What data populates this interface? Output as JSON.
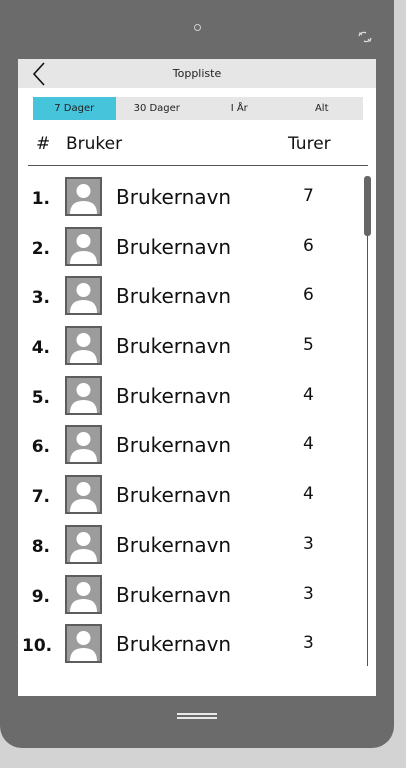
{
  "header": {
    "title": "Toppliste"
  },
  "tabs": [
    {
      "label": "7 Dager",
      "active": true
    },
    {
      "label": "30 Dager",
      "active": false
    },
    {
      "label": "I År",
      "active": false
    },
    {
      "label": "Alt",
      "active": false
    }
  ],
  "columns": {
    "rank": "#",
    "user": "Bruker",
    "trips": "Turer"
  },
  "rows": [
    {
      "rank": "1.",
      "name": "Brukernavn",
      "trips": "7"
    },
    {
      "rank": "2.",
      "name": "Brukernavn",
      "trips": "6"
    },
    {
      "rank": "3.",
      "name": "Brukernavn",
      "trips": "6"
    },
    {
      "rank": "4.",
      "name": "Brukernavn",
      "trips": "5"
    },
    {
      "rank": "5.",
      "name": "Brukernavn",
      "trips": "4"
    },
    {
      "rank": "6.",
      "name": "Brukernavn",
      "trips": "4"
    },
    {
      "rank": "7.",
      "name": "Brukernavn",
      "trips": "4"
    },
    {
      "rank": "8.",
      "name": "Brukernavn",
      "trips": "3"
    },
    {
      "rank": "9.",
      "name": "Brukernavn",
      "trips": "3"
    },
    {
      "rank": "10.",
      "name": "Brukernavn",
      "trips": "3"
    }
  ],
  "colors": {
    "active_tab": "#46c4dc",
    "device": "#6b6b6b",
    "avatar": "#9c9c9c"
  },
  "icons": {
    "back": "chevron-left-icon",
    "rotate": "rotate-icon",
    "avatar": "user-avatar-icon",
    "home": "home-menu-icon"
  }
}
